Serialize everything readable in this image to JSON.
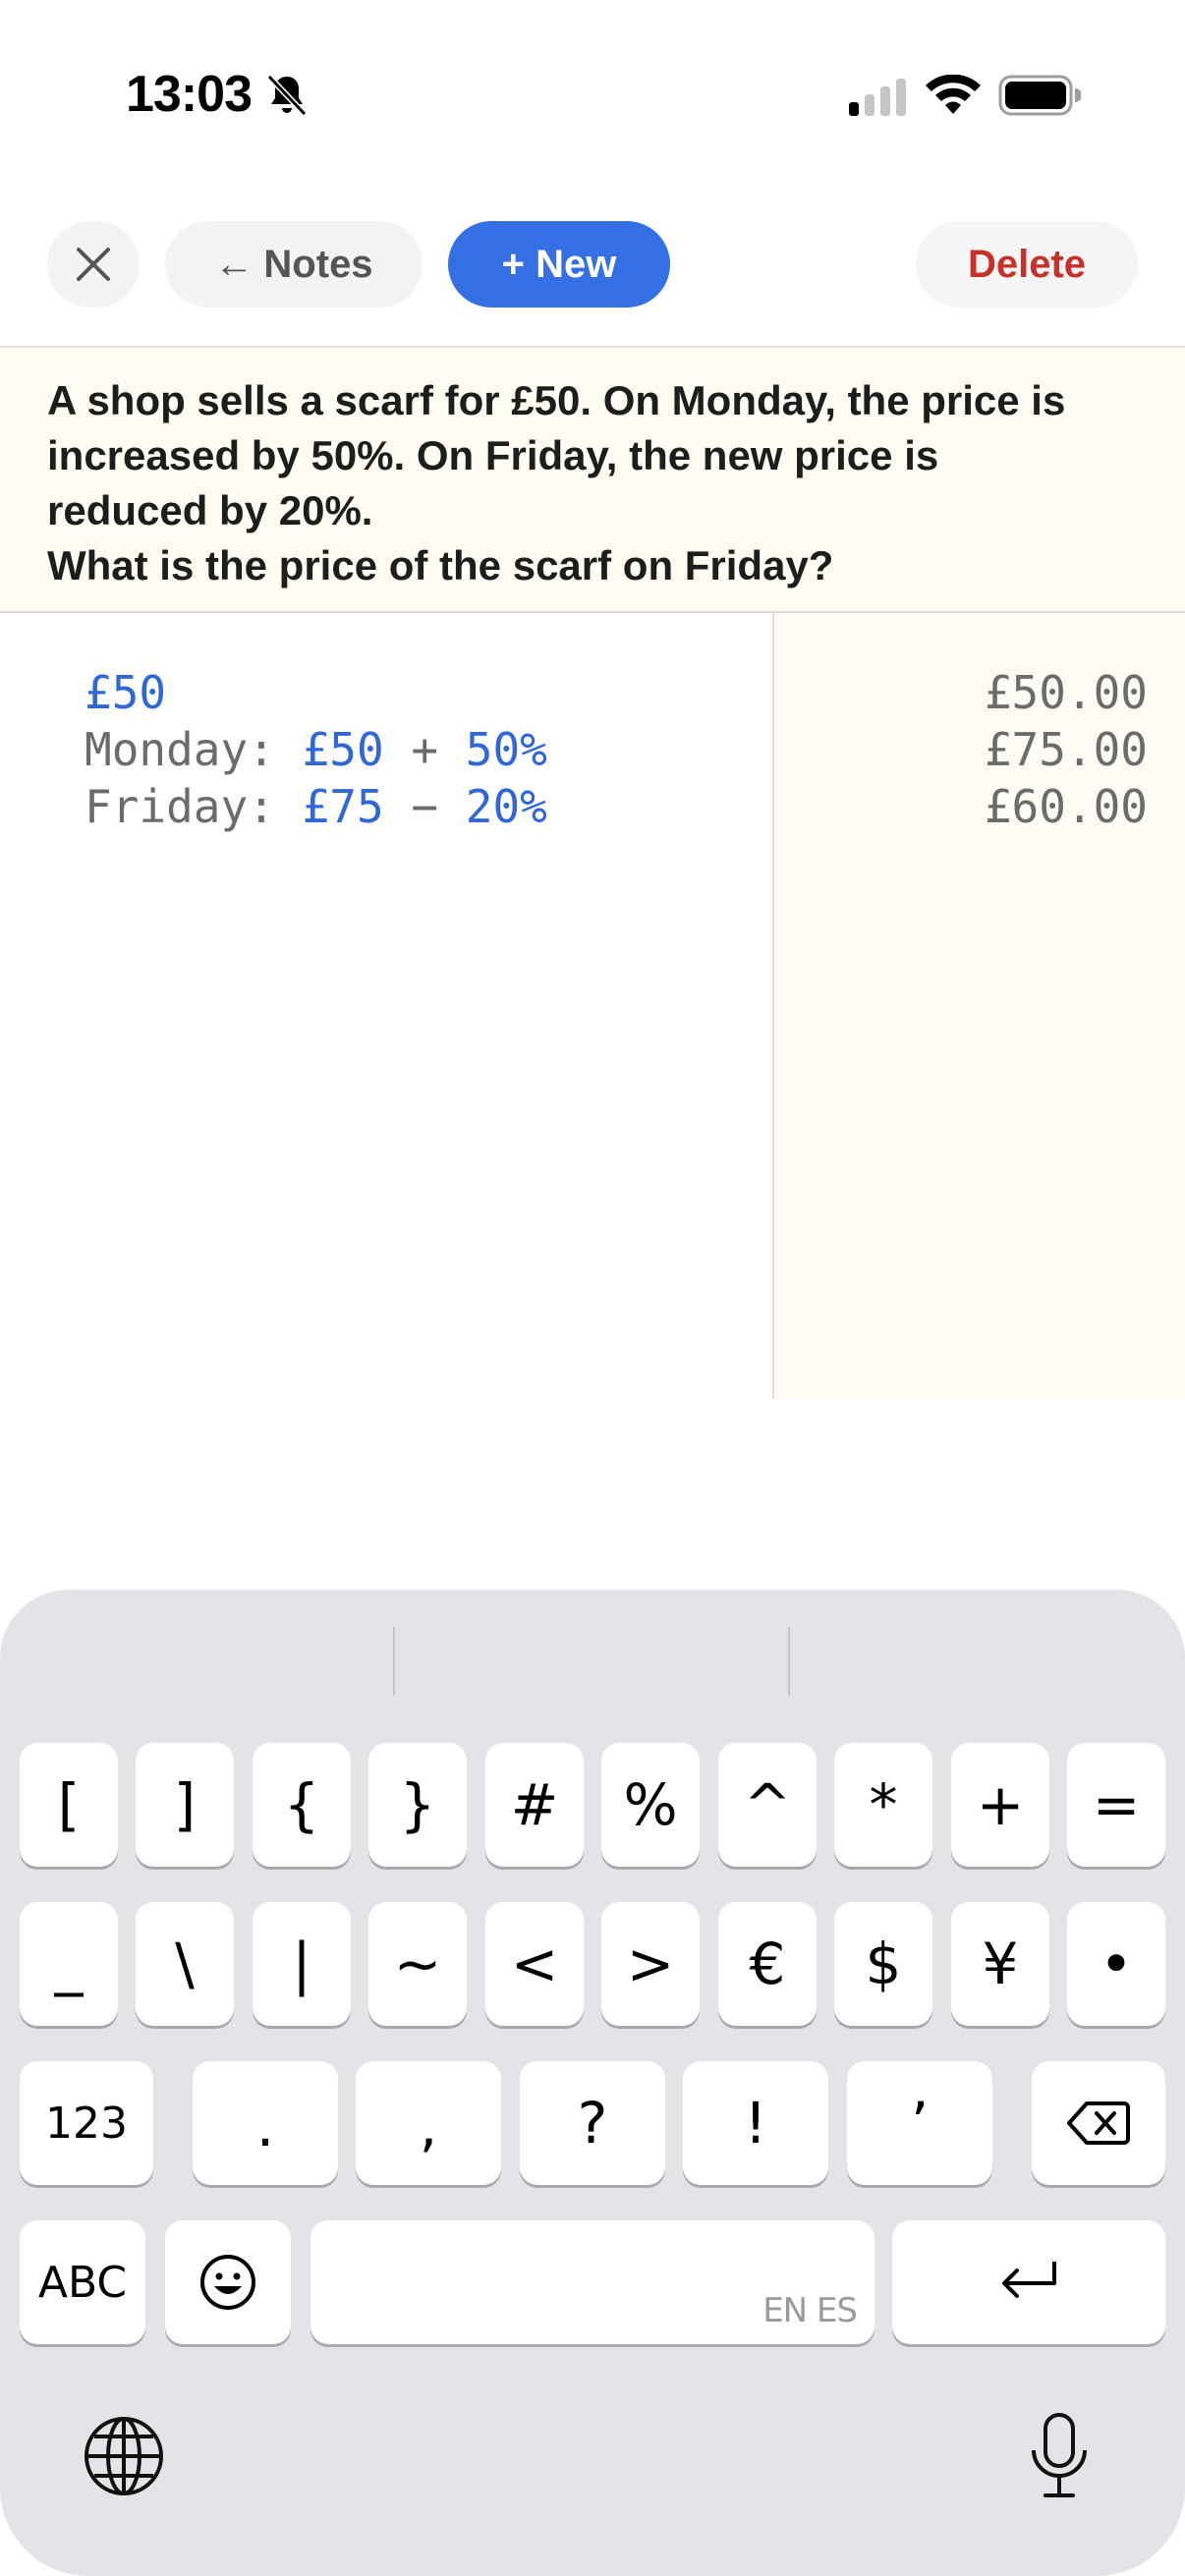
{
  "status_bar": {
    "time": "13:03"
  },
  "toolbar": {
    "close_label": "✕",
    "notes_arrow": "←",
    "notes_label": "Notes",
    "new_label": "+ New",
    "delete_label": "Delete"
  },
  "problem": {
    "lines": [
      "A shop sells a scarf for £50. On Monday, the price is",
      "increased by 50%. On Friday, the new price is",
      "reduced by 20%.",
      "What is the price of the scarf on Friday?"
    ]
  },
  "editor": {
    "line1": {
      "value": "£50"
    },
    "line2": {
      "label": "Monday: ",
      "a": "£50",
      "op": " + ",
      "b": "50%"
    },
    "line3": {
      "label": "Friday: ",
      "a": "£75",
      "op": " − ",
      "b": "20%"
    }
  },
  "results": [
    "£50.00",
    "£75.00",
    "£60.00"
  ],
  "keyboard": {
    "row1": [
      "[",
      "]",
      "{",
      "}",
      "#",
      "%",
      "^",
      "*",
      "+",
      "="
    ],
    "row2": [
      "_",
      "\\",
      "|",
      "~",
      "<",
      ">",
      "€",
      "$",
      "¥",
      "•"
    ],
    "row3": {
      "mode": "123",
      "keys": [
        ".",
        ",",
        "?",
        "!",
        "’"
      ]
    },
    "row4": {
      "abc": "ABC",
      "emoji": "😀",
      "space_hint": "EN ES"
    }
  },
  "colors": {
    "accent": "#3470e4",
    "delete": "#c8302a",
    "code_blue": "#2f66d8"
  }
}
